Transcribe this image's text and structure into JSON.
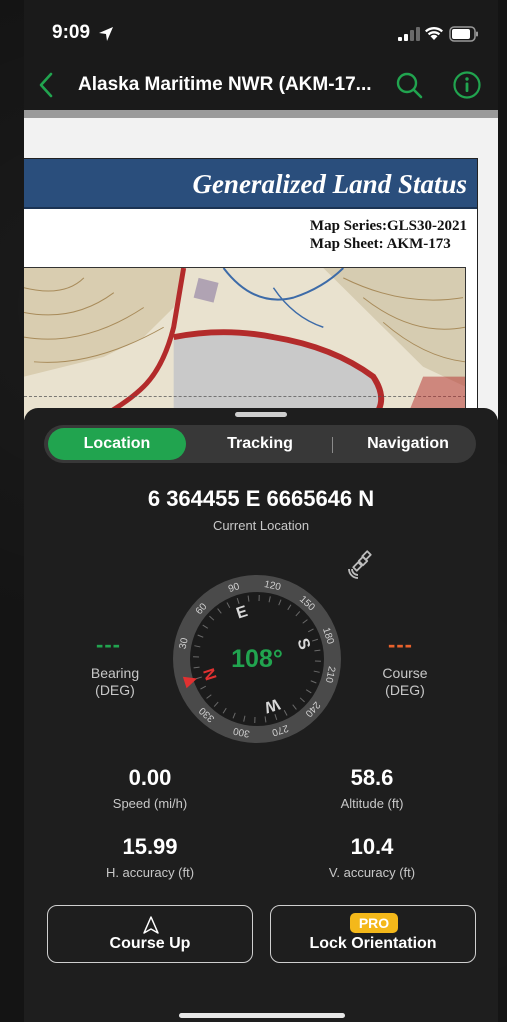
{
  "status_bar": {
    "time": "9:09"
  },
  "nav": {
    "title": "Alaska Maritime NWR (AKM-17..."
  },
  "map": {
    "banner_title": "Generalized Land Status",
    "series_line": "Map Series:GLS30-2021",
    "sheet_line": "Map Sheet: AKM-173"
  },
  "tabs": [
    {
      "label": "Location",
      "active": true
    },
    {
      "label": "Tracking",
      "active": false
    },
    {
      "label": "Navigation",
      "active": false
    }
  ],
  "location": {
    "coordinates": "6 364455 E 6665646 N",
    "coordinates_label": "Current Location"
  },
  "compass": {
    "heading_text": "108°",
    "heading_deg": 108,
    "cardinals": {
      "N": "N",
      "E": "E",
      "S": "S",
      "W": "W"
    },
    "ticks": [
      "30",
      "60",
      "90",
      "120",
      "150",
      "180",
      "210",
      "240",
      "270",
      "300",
      "330"
    ]
  },
  "bearing": {
    "value": "---",
    "label_line1": "Bearing",
    "label_line2": "(DEG)"
  },
  "course": {
    "value": "---",
    "label_line1": "Course",
    "label_line2": "(DEG)"
  },
  "stats": {
    "speed": {
      "value": "0.00",
      "label": "Speed (mi/h)"
    },
    "altitude": {
      "value": "58.6",
      "label": "Altitude (ft)"
    },
    "h_accuracy": {
      "value": "15.99",
      "label": "H. accuracy (ft)"
    },
    "v_accuracy": {
      "value": "10.4",
      "label": "V. accuracy (ft)"
    }
  },
  "buttons": {
    "course_up": "Course Up",
    "lock_orientation": "Lock Orientation",
    "pro_badge": "PRO"
  },
  "colors": {
    "accent_green": "#21a44f",
    "course_orange": "#e8612c",
    "pro_yellow": "#f4b81a",
    "map_banner": "#2a4e7c"
  },
  "icons": {
    "back": "chevron-left-icon",
    "search": "search-icon",
    "info": "info-icon",
    "satellite": "satellite-icon",
    "course_up": "navigation-arrow-icon"
  }
}
